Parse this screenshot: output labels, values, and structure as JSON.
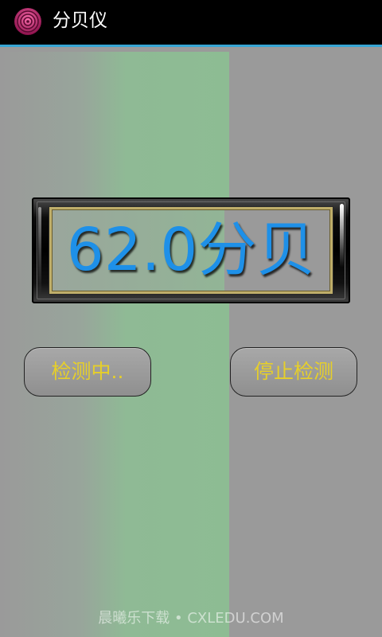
{
  "app": {
    "title": "分贝仪",
    "icon": "target-rings-icon",
    "accent_color": "#37a6d4"
  },
  "meter": {
    "reading": "62.0分贝",
    "value": 62.0,
    "unit": "分贝",
    "text_color": "#1e90e8"
  },
  "buttons": {
    "start_label": "检测中..",
    "stop_label": "停止检测",
    "text_color": "#e6cf2a"
  },
  "watermark": {
    "text": "晨曦乐下载 • CXLEDU.COM"
  },
  "colors": {
    "background": "#9a9a9a",
    "gradient_green": "#8dbc93"
  }
}
